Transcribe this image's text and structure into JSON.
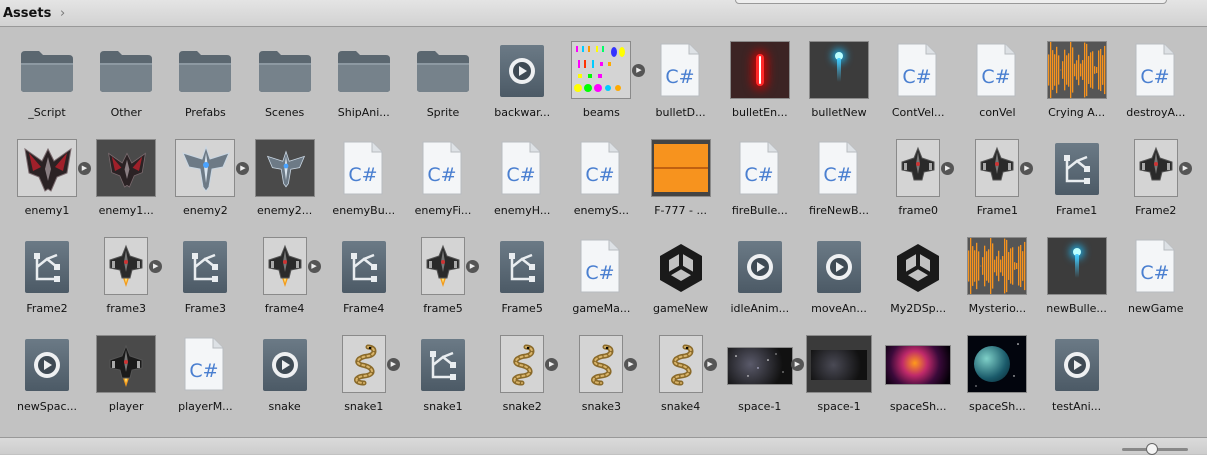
{
  "header": {
    "title": "Assets",
    "chevron": "›"
  },
  "rows": [
    [
      {
        "label": "_Script",
        "kind": "folder"
      },
      {
        "label": "Other",
        "kind": "folder"
      },
      {
        "label": "Prefabs",
        "kind": "folder"
      },
      {
        "label": "Scenes",
        "kind": "folder"
      },
      {
        "label": "ShipAni...",
        "kind": "folder"
      },
      {
        "label": "Sprite",
        "kind": "folder"
      },
      {
        "label": "backwar...",
        "kind": "anim"
      },
      {
        "label": "beams",
        "kind": "beams",
        "expand": true
      },
      {
        "label": "bulletD...",
        "kind": "cs"
      },
      {
        "label": "bulletEn...",
        "kind": "redbullet"
      },
      {
        "label": "bulletNew",
        "kind": "bluebullet"
      },
      {
        "label": "ContVel...",
        "kind": "cs"
      },
      {
        "label": "conVel",
        "kind": "cs"
      },
      {
        "label": "Crying A...",
        "kind": "audio"
      },
      {
        "label": "destroyA...",
        "kind": "cs"
      }
    ],
    [
      {
        "label": "enemy1",
        "kind": "enemy1",
        "expand": true
      },
      {
        "label": "enemy1...",
        "kind": "enemy1dark"
      },
      {
        "label": "enemy2",
        "kind": "enemy2",
        "expand": true
      },
      {
        "label": "enemy2...",
        "kind": "enemy2dark"
      },
      {
        "label": "enemyBu...",
        "kind": "cs"
      },
      {
        "label": "enemyFi...",
        "kind": "cs"
      },
      {
        "label": "enemyH...",
        "kind": "cs"
      },
      {
        "label": "enemyS...",
        "kind": "cs"
      },
      {
        "label": "F-777 - ...",
        "kind": "audiowide"
      },
      {
        "label": "fireBulle...",
        "kind": "cs"
      },
      {
        "label": "fireNewB...",
        "kind": "cs"
      },
      {
        "label": "frame0",
        "kind": "ship",
        "expand": true
      },
      {
        "label": "Frame1",
        "kind": "ship",
        "expand": true
      },
      {
        "label": "Frame1",
        "kind": "anctrl"
      },
      {
        "label": "Frame2",
        "kind": "ship",
        "expand": true
      }
    ],
    [
      {
        "label": "Frame2",
        "kind": "anctrl"
      },
      {
        "label": "frame3",
        "kind": "shipflame",
        "expand": true
      },
      {
        "label": "Frame3",
        "kind": "anctrl"
      },
      {
        "label": "frame4",
        "kind": "shipflame",
        "expand": true
      },
      {
        "label": "Frame4",
        "kind": "anctrl"
      },
      {
        "label": "frame5",
        "kind": "shipflame",
        "expand": true
      },
      {
        "label": "Frame5",
        "kind": "anctrl"
      },
      {
        "label": "gameMa...",
        "kind": "cs"
      },
      {
        "label": "gameNew",
        "kind": "unity"
      },
      {
        "label": "idleAnim...",
        "kind": "anim"
      },
      {
        "label": "moveAn...",
        "kind": "anim"
      },
      {
        "label": "My2DSp...",
        "kind": "unity"
      },
      {
        "label": "Mysterio...",
        "kind": "audio"
      },
      {
        "label": "newBulle...",
        "kind": "bluebullet"
      },
      {
        "label": "newGame",
        "kind": "cs"
      }
    ],
    [
      {
        "label": "newSpac...",
        "kind": "anim"
      },
      {
        "label": "player",
        "kind": "playerdark"
      },
      {
        "label": "playerM...",
        "kind": "cs"
      },
      {
        "label": "snake",
        "kind": "anim"
      },
      {
        "label": "snake1",
        "kind": "snakeimg",
        "expand": true
      },
      {
        "label": "snake1",
        "kind": "anctrl"
      },
      {
        "label": "snake2",
        "kind": "snakeimg",
        "expand": true
      },
      {
        "label": "snake3",
        "kind": "snakeimg",
        "expand": true
      },
      {
        "label": "snake4",
        "kind": "snakeimg",
        "expand": true
      },
      {
        "label": "space-1",
        "kind": "spacewide",
        "expand": true
      },
      {
        "label": "space-1",
        "kind": "spacedark"
      },
      {
        "label": "spaceSh...",
        "kind": "spacefire"
      },
      {
        "label": "spaceSh...",
        "kind": "planet"
      },
      {
        "label": "testAni...",
        "kind": "anim"
      }
    ]
  ],
  "footer": {
    "slider": "zoom-slider"
  },
  "colors": {
    "background": "#c2c2c2",
    "cs_text": "#4a7fd0",
    "audio": "#f7931e",
    "folder": "#6f7a83"
  }
}
